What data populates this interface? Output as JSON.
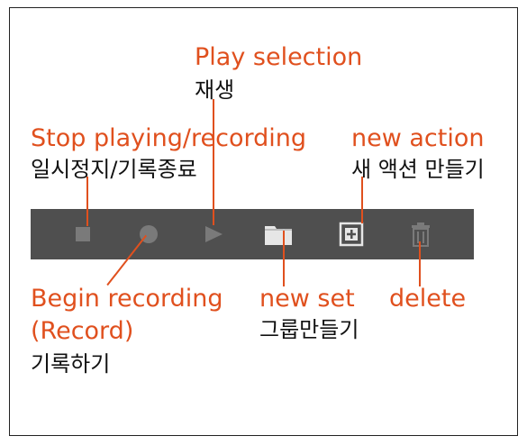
{
  "labels": {
    "play_selection": {
      "en": "Play selection",
      "ko": "재생"
    },
    "stop": {
      "en": "Stop playing/recording",
      "ko": "일시정지/기록종료"
    },
    "new_action": {
      "en": "new action",
      "ko": "새 액션 만들기"
    },
    "begin_recording": {
      "en_line1": "Begin recording",
      "en_line2": "(Record)",
      "ko": "기록하기"
    },
    "new_set": {
      "en": "new set",
      "ko": "그룹만들기"
    },
    "delete": {
      "en": "delete",
      "ko": "delete"
    }
  },
  "toolbar": {
    "buttons": [
      {
        "id": "stop",
        "icon": "square-stop-icon"
      },
      {
        "id": "record",
        "icon": "circle-record-icon"
      },
      {
        "id": "play",
        "icon": "triangle-play-icon"
      },
      {
        "id": "new_set",
        "icon": "folder-icon"
      },
      {
        "id": "new_action",
        "icon": "plus-box-icon"
      },
      {
        "id": "delete",
        "icon": "trash-icon"
      }
    ]
  },
  "colors": {
    "annotation": "#e0501e",
    "toolbar_bg": "#4f4f4f",
    "icon_dim": "#777777",
    "icon_bright": "#e6e6e6"
  }
}
